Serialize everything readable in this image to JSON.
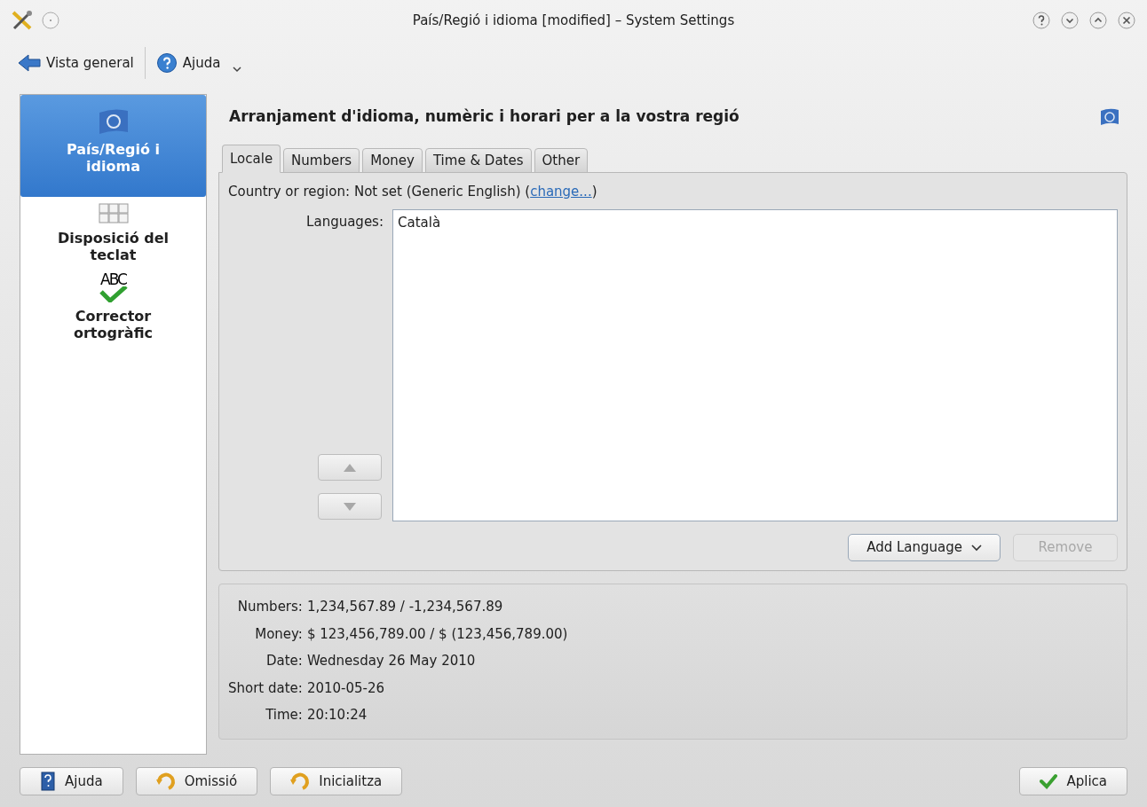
{
  "window": {
    "title": "País/Regió i idioma [modified] – System Settings"
  },
  "toolbar": [
    {
      "kind": "back",
      "label": "Vista general"
    },
    {
      "kind": "help",
      "label": "Ajuda"
    }
  ],
  "sidebar": {
    "items": [
      {
        "kind": "flag",
        "label": "País/Regió i idioma",
        "selected": true
      },
      {
        "kind": "keyboard",
        "label": "Disposició del teclat",
        "selected": false
      },
      {
        "kind": "spell",
        "icon_text": "ABC",
        "label": "Corrector ortogràfic",
        "selected": false
      }
    ]
  },
  "header": {
    "title": "Arranjament d'idioma, numèric i horari per a la vostra regió"
  },
  "tabs": [
    {
      "label": "Locale",
      "selected": true
    },
    {
      "label": "Numbers",
      "selected": false
    },
    {
      "label": "Money",
      "selected": false
    },
    {
      "label": "Time & Dates",
      "selected": false
    },
    {
      "label": "Other",
      "selected": false
    }
  ],
  "locale": {
    "country_label": "Country or region:",
    "country_value": "Not set (Generic English) (",
    "change_link": "change...",
    "country_close": ")",
    "languages_label": "Languages:",
    "languages": [
      {
        "name": "Català",
        "selected": false
      }
    ],
    "add_button": {
      "label": "Add Language",
      "disabled": false
    },
    "remove_button": {
      "label": "Remove",
      "disabled": true
    }
  },
  "preview": [
    {
      "label": "Numbers:",
      "value": "1,234,567.89 / -1,234,567.89"
    },
    {
      "label": "Money:",
      "value": "$ 123,456,789.00 / $ (123,456,789.00)"
    },
    {
      "label": "Date:",
      "value": "Wednesday 26 May 2010"
    },
    {
      "label": "Short date:",
      "value": "2010-05-26"
    },
    {
      "label": "Time:",
      "value": "20:10:24"
    }
  ],
  "footer": [
    {
      "kind": "help",
      "label": "Ajuda"
    },
    {
      "kind": "defaults",
      "label": "Omissió"
    },
    {
      "kind": "reset",
      "label": "Inicialitza"
    },
    {
      "kind": "apply",
      "label": "Aplica"
    }
  ]
}
